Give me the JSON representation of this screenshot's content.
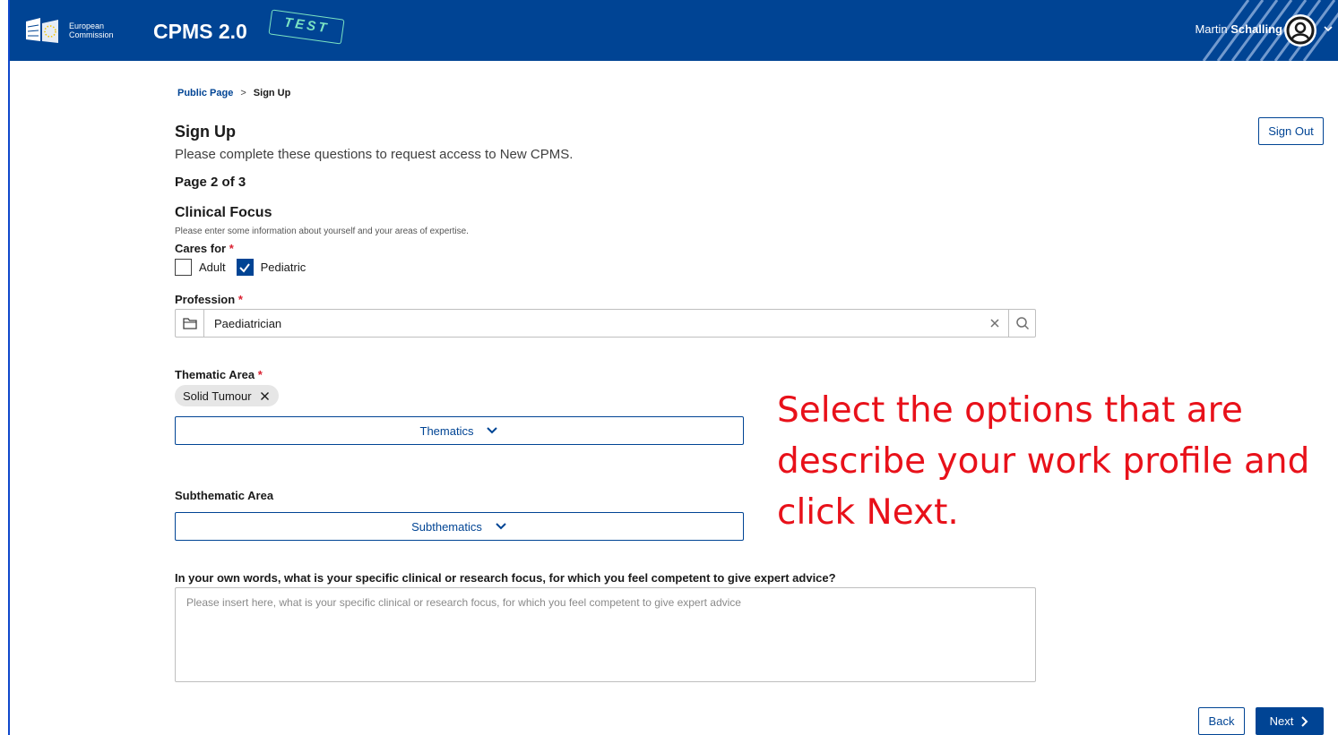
{
  "header": {
    "logo_line1": "European",
    "logo_line2": "Commission",
    "app_title": "CPMS 2.0",
    "test_stamp": "TEST",
    "user_first": "Martin",
    "user_last": "Schalling"
  },
  "breadcrumb": {
    "link": "Public Page",
    "separator": ">",
    "current": "Sign Up"
  },
  "page": {
    "title": "Sign Up",
    "intro": "Please complete these questions to request access to New CPMS.",
    "page_count": "Page 2 of 3",
    "sign_out": "Sign Out"
  },
  "section": {
    "title": "Clinical Focus",
    "help": "Please enter some information about yourself and your areas of expertise."
  },
  "cares_for": {
    "label": "Cares for",
    "required": "*",
    "options": [
      {
        "label": "Adult",
        "checked": false
      },
      {
        "label": "Pediatric",
        "checked": true
      }
    ]
  },
  "profession": {
    "label": "Profession",
    "required": "*",
    "value": "Paediatrician"
  },
  "thematic": {
    "label": "Thematic Area",
    "required": "*",
    "selected_tag": "Solid Tumour",
    "dropdown_label": "Thematics"
  },
  "subthematic": {
    "label": "Subthematic Area",
    "dropdown_label": "Subthematics"
  },
  "focus": {
    "question": "In your own words, what is your specific clinical or research focus, for which you feel competent to give expert advice?",
    "placeholder": "Please insert here, what is your specific clinical or research focus, for which you feel competent to give expert advice"
  },
  "actions": {
    "back": "Back",
    "next": "Next"
  },
  "instruction_overlay": "Select the options that are describe your work profile and click Next.",
  "colors": {
    "brand_blue": "#004494",
    "required_red": "#da2131",
    "annotation_red": "#e8111a",
    "test_green": "#7be3c3"
  }
}
